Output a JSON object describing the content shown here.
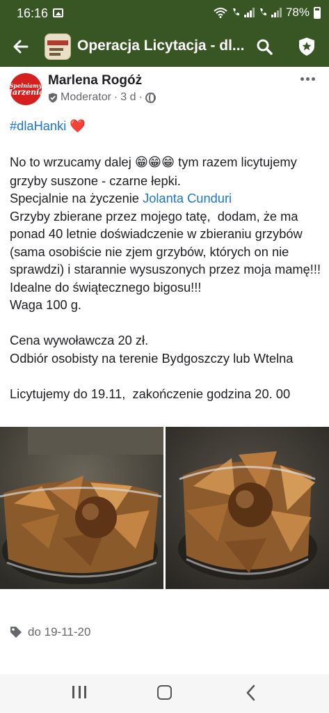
{
  "status_bar": {
    "time": "16:16",
    "battery": "78%",
    "battery_level": 0.78
  },
  "app_bar": {
    "title": "Operacja Licytacja - dl...",
    "back_icon": "arrow-left-icon",
    "search_icon": "search-icon",
    "admin_icon": "shield-star-icon"
  },
  "post": {
    "author": "Marlena Rogóż",
    "avatar_text": [
      "Spełniamy",
      "Marzenia!"
    ],
    "role": "Moderator",
    "time": "3 d",
    "hashtag": "#dlaHanki",
    "heart": "❤️",
    "line1_start": "No to wrzucamy dalej ",
    "line1_emoji": "😁😁😁",
    "line1_end": " tym razem licytujemy  grzyby suszone - czarne łepki.",
    "line2_start": "Specjalnie na życzenie ",
    "mention": "Jolanta Cunduri",
    "line3": "Grzyby zbierane przez mojego tatę,  dodam, że ma ponad 40 letnie doświadczenie w zbieraniu grzybów (sama osobiście nie zjem grzybów, których on nie sprawdzi) i starannie wysuszonych przez moja mamę!!! Idealne do świątecznego bigosu!!!",
    "line4": "Waga 100 g.",
    "line5": "Cena wywoławcza 20 zł.",
    "line6": "Odbiór osobisty na terenie Bydgoszczy lub Wtelna",
    "line7": "Licytujemy do 19.11,  zakończenie godzina 20. 00",
    "tag": "do 19-11-20"
  },
  "colors": {
    "app_bar": "#385623",
    "link": "#1976d2",
    "secondary_text": "#65676b"
  }
}
